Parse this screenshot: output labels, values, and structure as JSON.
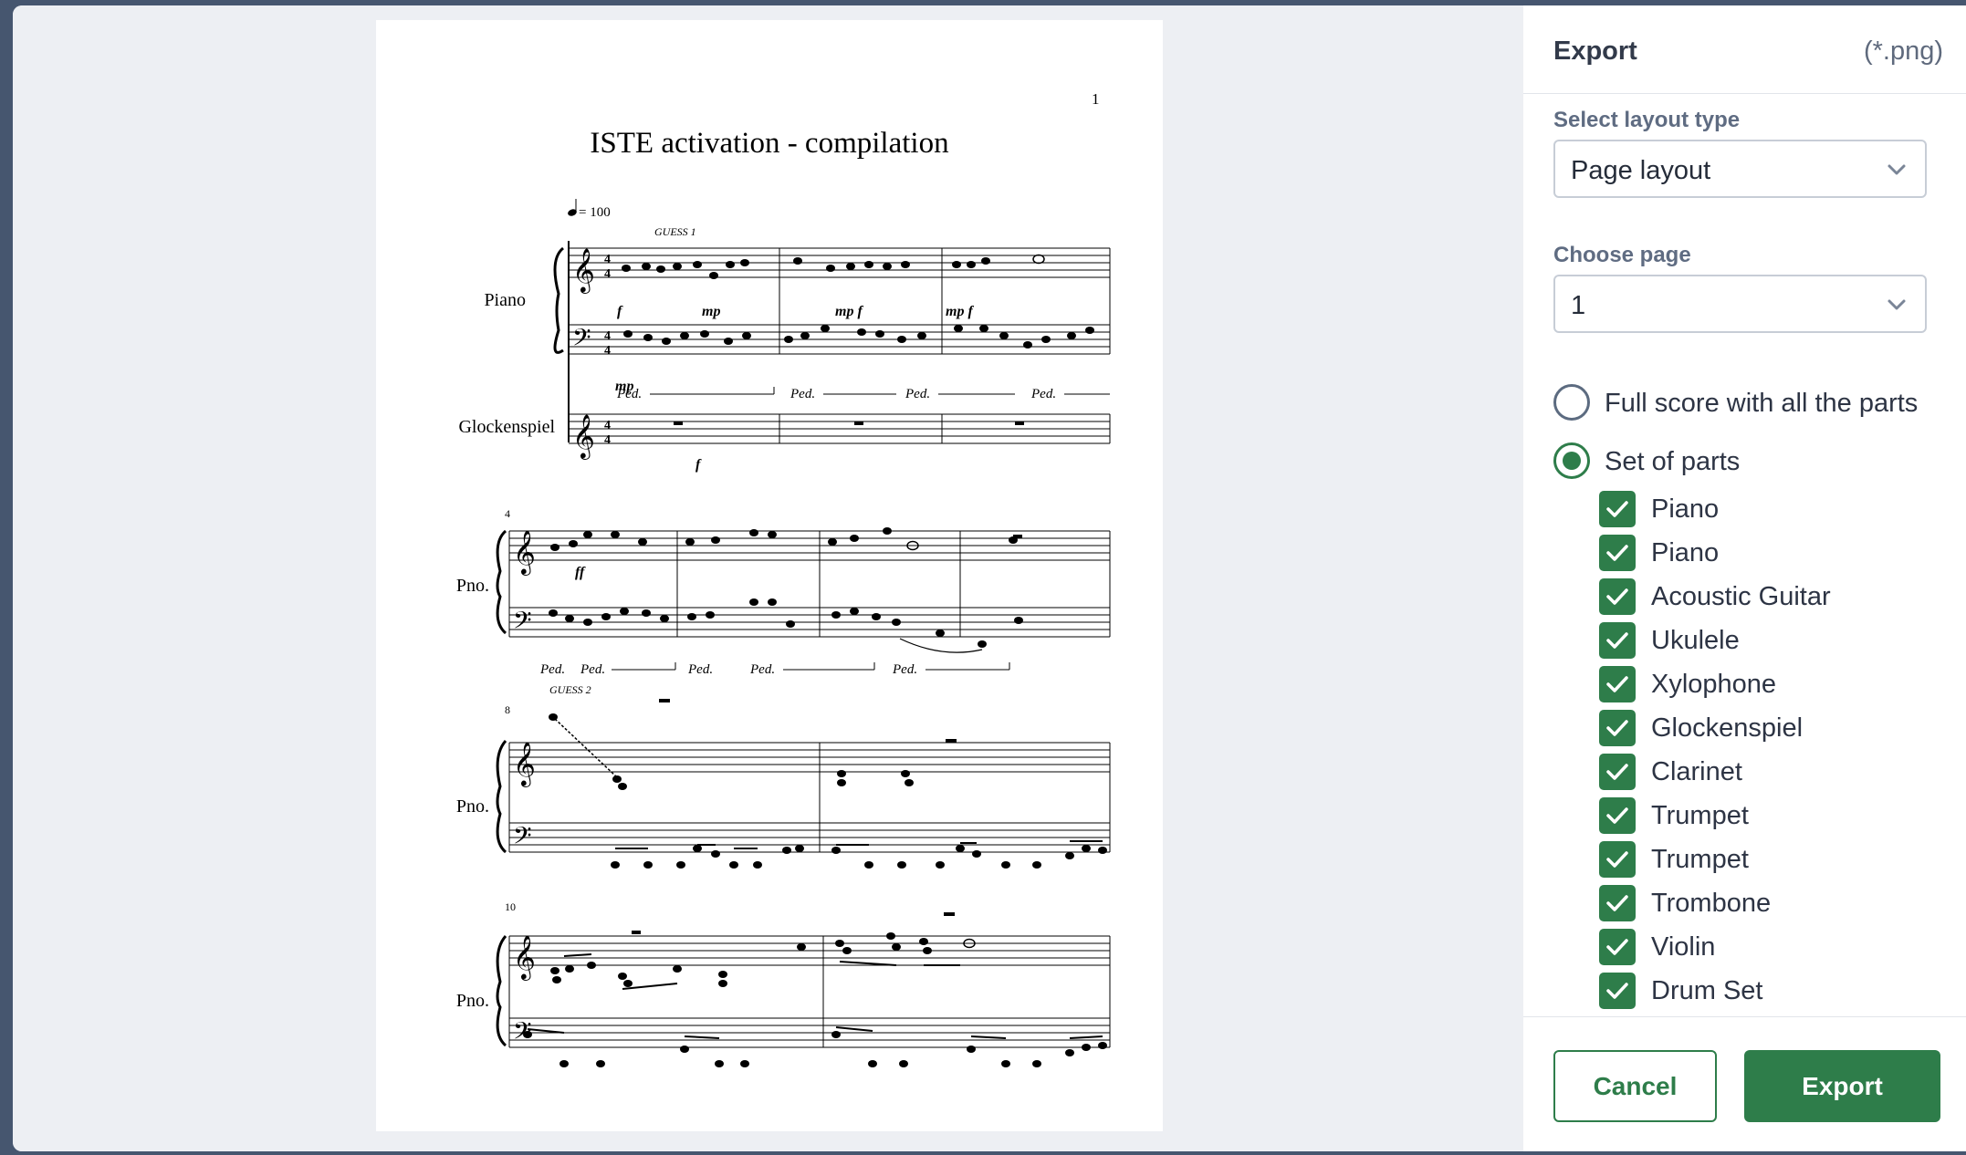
{
  "score": {
    "page_number": "1",
    "title": "ISTE activation - compilation",
    "tempo": "= 100",
    "rehearsal_marks": [
      "GUESS 1",
      "GUESS 2"
    ],
    "systems": [
      {
        "instruments": [
          "Piano",
          "Glockenspiel"
        ],
        "measure_number": ""
      },
      {
        "instruments": [
          "Pno."
        ],
        "measure_number": "4"
      },
      {
        "instruments": [
          "Pno."
        ],
        "measure_number": "8"
      },
      {
        "instruments": [
          "Pno."
        ],
        "measure_number": "10"
      }
    ],
    "dynamics": [
      "f",
      "mp",
      "mp f",
      "mp f",
      "mp",
      "f",
      "ff"
    ],
    "pedal_mark": "Ped."
  },
  "export_panel": {
    "title": "Export",
    "extension": "(*.png)",
    "layout_label": "Select layout type",
    "layout_value": "Page layout",
    "page_label": "Choose page",
    "page_value": "1",
    "options": [
      {
        "label": "Full score with all the parts",
        "selected": false
      },
      {
        "label": "Set of parts",
        "selected": true
      }
    ],
    "parts": [
      {
        "label": "Piano",
        "checked": true
      },
      {
        "label": "Piano",
        "checked": true
      },
      {
        "label": "Acoustic Guitar",
        "checked": true
      },
      {
        "label": "Ukulele",
        "checked": true
      },
      {
        "label": "Xylophone",
        "checked": true
      },
      {
        "label": "Glockenspiel",
        "checked": true
      },
      {
        "label": "Clarinet",
        "checked": true
      },
      {
        "label": "Trumpet",
        "checked": true
      },
      {
        "label": "Trumpet",
        "checked": true
      },
      {
        "label": "Trombone",
        "checked": true
      },
      {
        "label": "Violin",
        "checked": true
      },
      {
        "label": "Drum Set",
        "checked": true
      }
    ],
    "cancel_label": "Cancel",
    "export_label": "Export"
  },
  "colors": {
    "accent": "#2e7d4a",
    "panel_bg": "#ffffff",
    "preview_bg": "#edeff3"
  }
}
